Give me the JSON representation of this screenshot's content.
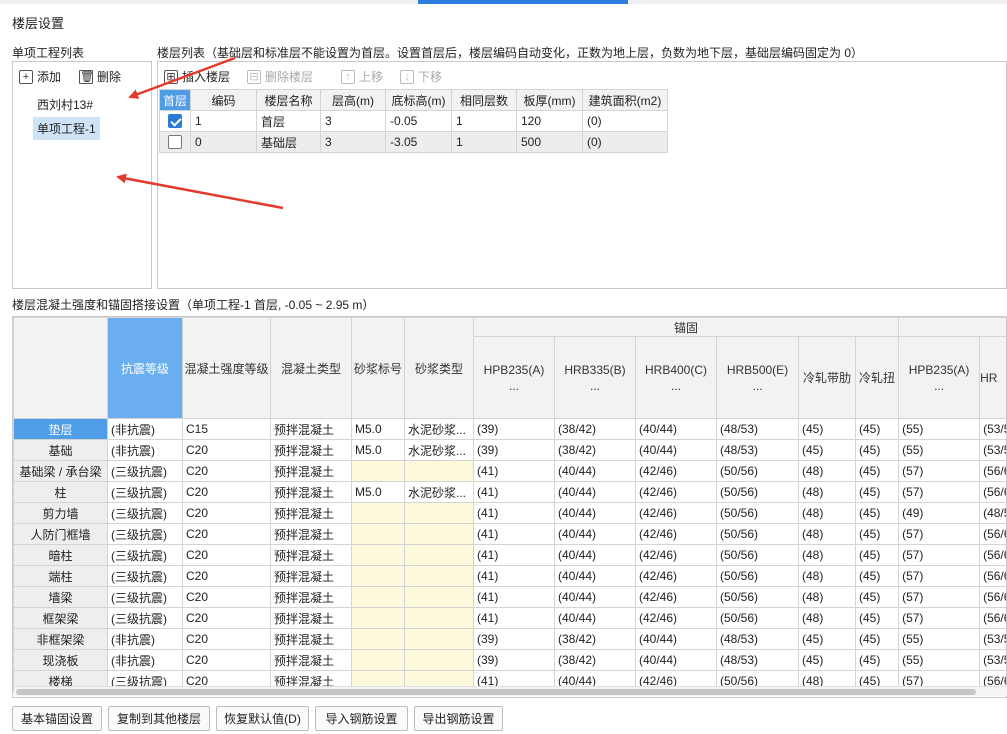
{
  "dialog": {
    "title": "楼层设置"
  },
  "project_panel": {
    "label": "单项工程列表",
    "add_label": "添加",
    "delete_label": "删除",
    "items": [
      "西刘村13#",
      "单项工程-1"
    ]
  },
  "floor_panel": {
    "label": "楼层列表（基础层和标准层不能设置为首层。设置首层后，楼层编码自动变化，正数为地上层，负数为地下层，基础层编码固定为 0）",
    "toolbar": {
      "insert": "插入楼层",
      "delete": "删除楼层",
      "up": "上移",
      "down": "下移"
    },
    "columns": [
      "首层",
      "编码",
      "楼层名称",
      "层高(m)",
      "底标高(m)",
      "相同层数",
      "板厚(mm)",
      "建筑面积(m2)"
    ],
    "rows": [
      {
        "checked": true,
        "code": "1",
        "name": "首层",
        "height": "3",
        "bottom": "-0.05",
        "same": "1",
        "thick": "120",
        "area": "(0)"
      },
      {
        "checked": false,
        "code": "0",
        "name": "基础层",
        "height": "3",
        "bottom": "-3.05",
        "same": "1",
        "thick": "500",
        "area": "(0)"
      }
    ]
  },
  "concrete_panel": {
    "label": "楼层混凝土强度和锚固搭接设置（单项工程-1  首层, -0.05 ~ 2.95 m）",
    "group_header": "锚固",
    "columns": [
      "抗震等级",
      "混凝土强度等级",
      "混凝土类型",
      "砂浆标号",
      "砂浆类型",
      "HPB235(A)\n...",
      "HRB335(B)\n...",
      "HRB400(C)\n...",
      "HRB500(E)\n...",
      "冷轧带肋",
      "冷轧扭",
      "HPB235(A)\n...",
      "HR"
    ],
    "rows": [
      {
        "name": "垫层",
        "cells": [
          "(非抗震)",
          "C15",
          "预拌混凝土",
          "M5.0",
          "水泥砂浆...",
          "(39)",
          "(38/42)",
          "(40/44)",
          "(48/53)",
          "(45)",
          "(45)",
          "(55)",
          "(53/5"
        ]
      },
      {
        "name": "基础",
        "cells": [
          "(非抗震)",
          "C20",
          "预拌混凝土",
          "M5.0",
          "水泥砂浆...",
          "(39)",
          "(38/42)",
          "(40/44)",
          "(48/53)",
          "(45)",
          "(45)",
          "(55)",
          "(53/5"
        ]
      },
      {
        "name": "基础梁 / 承台梁",
        "cells": [
          "(三级抗震)",
          "C20",
          "预拌混凝土",
          "",
          "",
          "(41)",
          "(40/44)",
          "(42/46)",
          "(50/56)",
          "(48)",
          "(45)",
          "(57)",
          "(56/6"
        ]
      },
      {
        "name": "柱",
        "cells": [
          "(三级抗震)",
          "C20",
          "预拌混凝土",
          "M5.0",
          "水泥砂浆...",
          "(41)",
          "(40/44)",
          "(42/46)",
          "(50/56)",
          "(48)",
          "(45)",
          "(57)",
          "(56/6"
        ]
      },
      {
        "name": "剪力墙",
        "cells": [
          "(三级抗震)",
          "C20",
          "预拌混凝土",
          "",
          "",
          "(41)",
          "(40/44)",
          "(42/46)",
          "(50/56)",
          "(48)",
          "(45)",
          "(49)",
          "(48/5"
        ]
      },
      {
        "name": "人防门框墙",
        "cells": [
          "(三级抗震)",
          "C20",
          "预拌混凝土",
          "",
          "",
          "(41)",
          "(40/44)",
          "(42/46)",
          "(50/56)",
          "(48)",
          "(45)",
          "(57)",
          "(56/6"
        ]
      },
      {
        "name": "暗柱",
        "cells": [
          "(三级抗震)",
          "C20",
          "预拌混凝土",
          "",
          "",
          "(41)",
          "(40/44)",
          "(42/46)",
          "(50/56)",
          "(48)",
          "(45)",
          "(57)",
          "(56/6"
        ]
      },
      {
        "name": "端柱",
        "cells": [
          "(三级抗震)",
          "C20",
          "预拌混凝土",
          "",
          "",
          "(41)",
          "(40/44)",
          "(42/46)",
          "(50/56)",
          "(48)",
          "(45)",
          "(57)",
          "(56/6"
        ]
      },
      {
        "name": "墙梁",
        "cells": [
          "(三级抗震)",
          "C20",
          "预拌混凝土",
          "",
          "",
          "(41)",
          "(40/44)",
          "(42/46)",
          "(50/56)",
          "(48)",
          "(45)",
          "(57)",
          "(56/6"
        ]
      },
      {
        "name": "框架梁",
        "cells": [
          "(三级抗震)",
          "C20",
          "预拌混凝土",
          "",
          "",
          "(41)",
          "(40/44)",
          "(42/46)",
          "(50/56)",
          "(48)",
          "(45)",
          "(57)",
          "(56/6"
        ]
      },
      {
        "name": "非框架梁",
        "cells": [
          "(非抗震)",
          "C20",
          "预拌混凝土",
          "",
          "",
          "(39)",
          "(38/42)",
          "(40/44)",
          "(48/53)",
          "(45)",
          "(45)",
          "(55)",
          "(53/5"
        ]
      },
      {
        "name": "现浇板",
        "cells": [
          "(非抗震)",
          "C20",
          "预拌混凝土",
          "",
          "",
          "(39)",
          "(38/42)",
          "(40/44)",
          "(48/53)",
          "(45)",
          "(45)",
          "(55)",
          "(53/5"
        ]
      },
      {
        "name": "楼梯",
        "cells": [
          "(三级抗震)",
          "C20",
          "预拌混凝土",
          "",
          "",
          "(41)",
          "(40/44)",
          "(42/46)",
          "(50/56)",
          "(48)",
          "(45)",
          "(57)",
          "(56/6"
        ]
      }
    ]
  },
  "buttons": [
    "基本锚固设置",
    "复制到其他楼层",
    "恢复默认值(D)",
    "导入钢筋设置",
    "导出钢筋设置"
  ],
  "colors": {
    "accent": "#2b7de1",
    "selected_header": "#4e9de6",
    "annotation_arrow": "#e23b2e",
    "editable_cell": "#fbf8dc"
  }
}
